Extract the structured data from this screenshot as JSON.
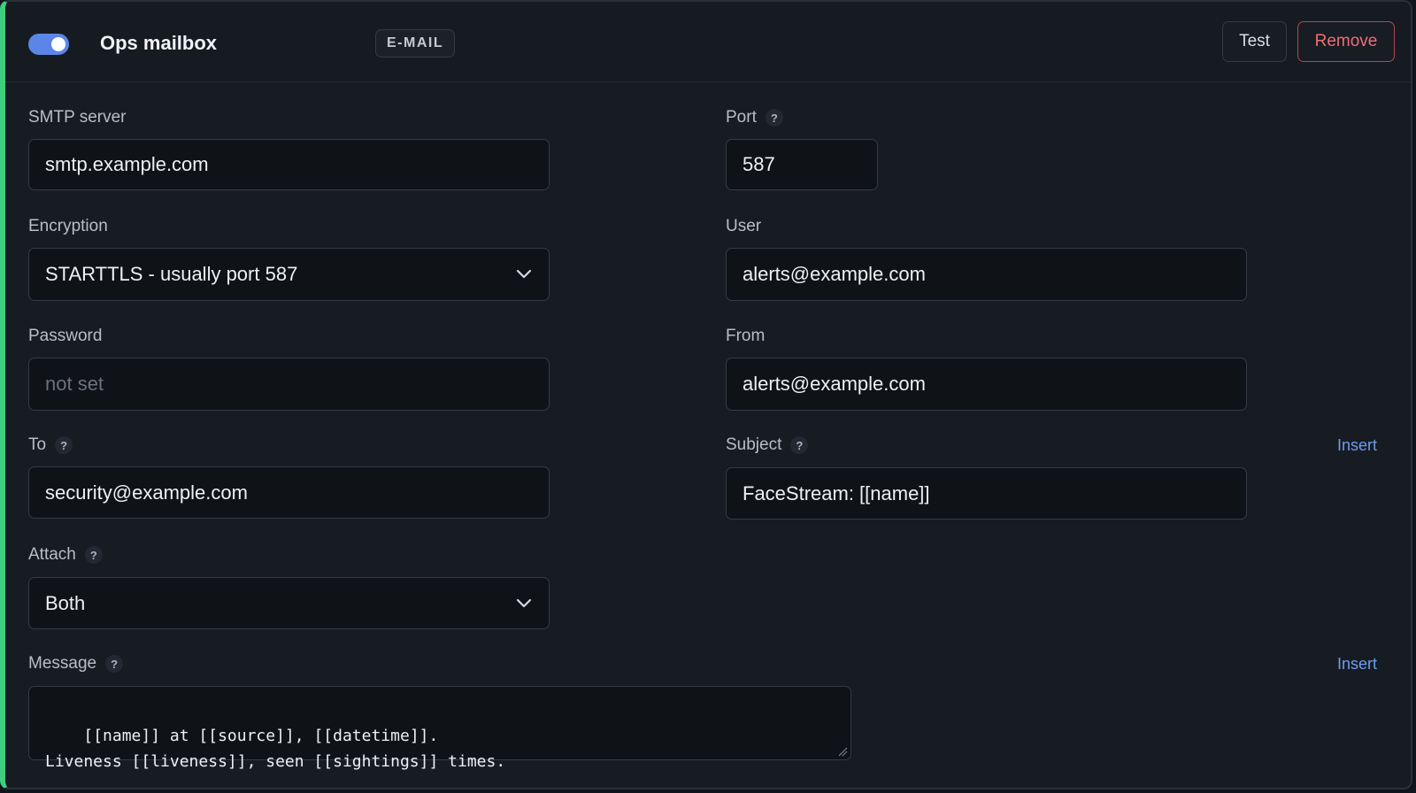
{
  "header": {
    "enabled": true,
    "title": "Ops mailbox",
    "type_badge": "E-MAIL",
    "test_label": "Test",
    "remove_label": "Remove"
  },
  "fields": {
    "smtp_server": {
      "label": "SMTP server",
      "value": "smtp.example.com"
    },
    "port": {
      "label": "Port",
      "value": "587"
    },
    "encryption": {
      "label": "Encryption",
      "value": "STARTTLS - usually port 587"
    },
    "user": {
      "label": "User",
      "value": "alerts@example.com"
    },
    "password": {
      "label": "Password",
      "placeholder": "not set"
    },
    "from": {
      "label": "From",
      "value": "alerts@example.com"
    },
    "to": {
      "label": "To",
      "value": "security@example.com"
    },
    "subject": {
      "label": "Subject",
      "value": "FaceStream: [[name]]",
      "insert_label": "Insert"
    },
    "attach": {
      "label": "Attach",
      "value": "Both"
    },
    "message": {
      "label": "Message",
      "value": "[[name]] at [[source]], [[datetime]].\nLiveness [[liveness]], seen [[sightings]] times.",
      "insert_label": "Insert"
    }
  },
  "help_glyph": "?",
  "colors": {
    "accent_stripe": "#3ecf7e",
    "toggle_on": "#5b86e8",
    "remove": "#ef6e77",
    "link": "#6f9cf0"
  },
  "icons": {
    "toggle": "toggle-switch-icon",
    "help": "question-mark-icon",
    "dropdown": "chevron-down-icon",
    "resize": "resize-grip-icon"
  }
}
